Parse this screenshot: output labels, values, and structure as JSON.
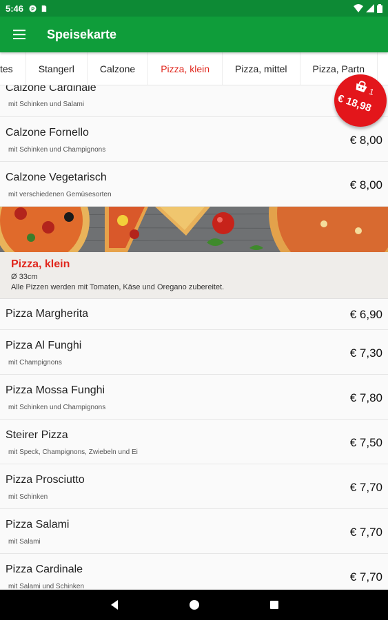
{
  "status_bar": {
    "time": "5:46",
    "icons": [
      "p-icon",
      "sim-icon",
      "wifi-icon",
      "signal-icon",
      "battery-icon"
    ]
  },
  "app_bar": {
    "title": "Speisekarte",
    "menu_icon": "hamburger-icon"
  },
  "tabs": [
    {
      "label": "tes",
      "active": false
    },
    {
      "label": "Stangerl",
      "active": false
    },
    {
      "label": "Calzone",
      "active": false
    },
    {
      "label": "Pizza, klein",
      "active": true
    },
    {
      "label": "Pizza, mittel",
      "active": false
    },
    {
      "label": "Pizza, Partn",
      "active": false
    }
  ],
  "calzone_items": [
    {
      "name": "Calzone Cardinale",
      "desc": "mit Schinken und Salami",
      "price": ""
    },
    {
      "name": "Calzone Fornello",
      "desc": "mit Schinken und Champignons",
      "price": "€ 8,00"
    },
    {
      "name": "Calzone Vegetarisch",
      "desc": "mit verschiedenen Gemüsesorten",
      "price": "€ 8,00"
    }
  ],
  "section": {
    "title": "Pizza, klein",
    "subtitle": "Ø 33cm",
    "note": "Alle Pizzen werden mit Tomaten, Käse und Oregano zubereitet."
  },
  "pizza_items": [
    {
      "name": "Pizza Margherita",
      "desc": "",
      "price": "€ 6,90"
    },
    {
      "name": "Pizza Al Funghi",
      "desc": "mit Champignons",
      "price": "€ 7,30"
    },
    {
      "name": "Pizza Mossa Funghi",
      "desc": "mit Schinken und Champignons",
      "price": "€ 7,80"
    },
    {
      "name": "Steirer Pizza",
      "desc": "mit Speck, Champignons, Zwiebeln und Ei",
      "price": "€ 7,50"
    },
    {
      "name": "Pizza Prosciutto",
      "desc": "mit Schinken",
      "price": "€ 7,70"
    },
    {
      "name": "Pizza Salami",
      "desc": "mit Salami",
      "price": "€ 7,70"
    },
    {
      "name": "Pizza Cardinale",
      "desc": "mit Salami und Schinken",
      "price": "€ 7,70"
    }
  ],
  "cart": {
    "count": "1",
    "total": "€ 18,98",
    "icon": "shopping-bag-icon"
  },
  "nav_bar": {
    "icons": [
      "back-icon",
      "home-icon",
      "recents-icon"
    ]
  },
  "colors": {
    "primary": "#0f9d3a",
    "status": "#0d8a35",
    "accent": "#e0261c",
    "cart": "#e3161b"
  }
}
